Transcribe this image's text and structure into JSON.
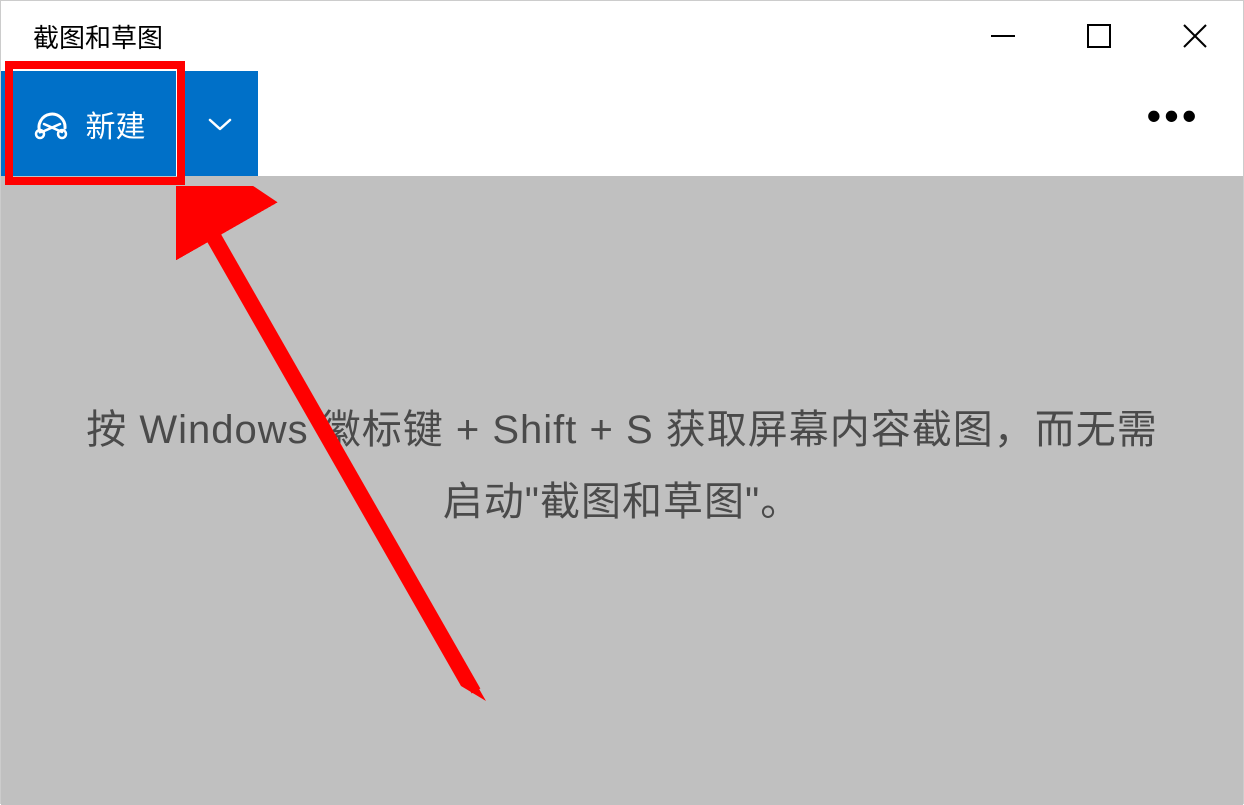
{
  "window": {
    "title": "截图和草图"
  },
  "toolbar": {
    "new_label": "新建"
  },
  "content": {
    "hint": "按 Windows 徽标键 + Shift + S 获取屏幕内容截图，而无需启动\"截图和草图\"。"
  },
  "colors": {
    "accent": "#0070c8",
    "highlight": "#ff0000"
  }
}
